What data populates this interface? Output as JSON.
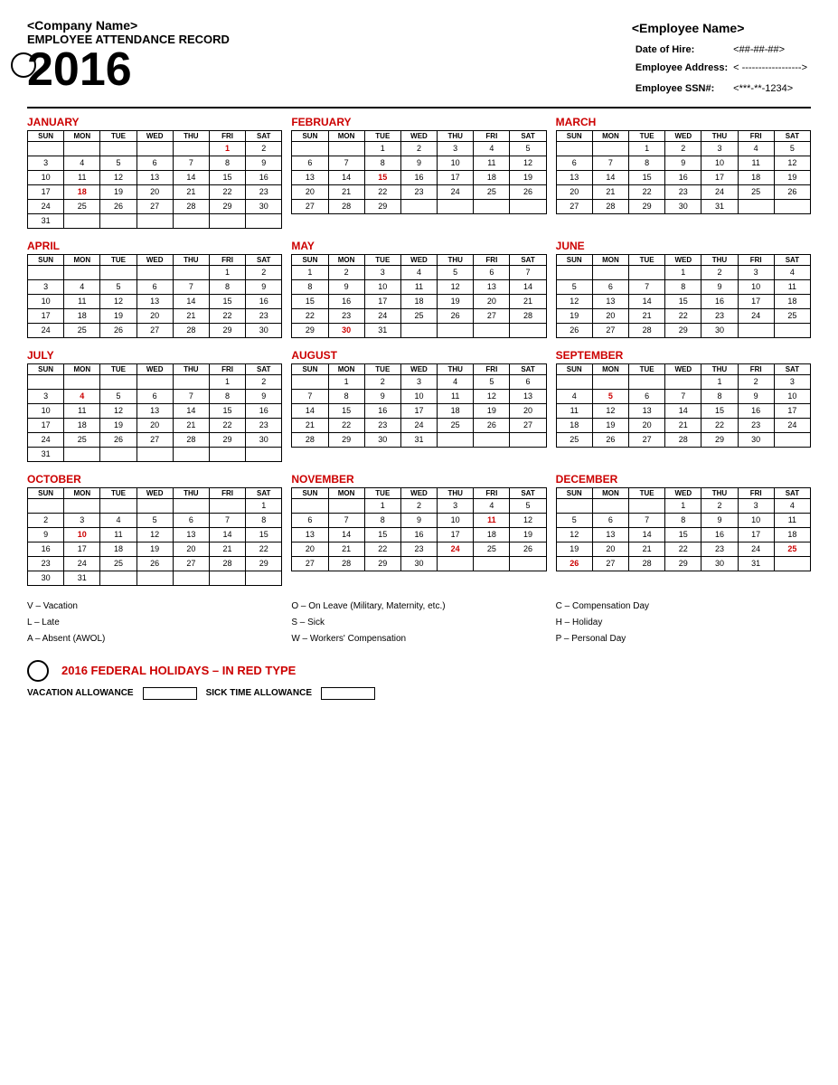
{
  "header": {
    "company_name": "<Company Name>",
    "record_title": "EMPLOYEE ATTENDANCE RECORD",
    "year": "2016",
    "employee_name": "<Employee Name>",
    "date_of_hire_label": "Date of Hire:",
    "date_of_hire_value": "<##-##-##>",
    "address_label": "Employee Address:",
    "address_value": "< ------------------>",
    "ssn_label": "Employee SSN#:",
    "ssn_value": "<***-**-1234>"
  },
  "months": [
    {
      "name": "JANUARY",
      "days": [
        "",
        "",
        "",
        "",
        "",
        "1",
        "2",
        "3",
        "4",
        "5",
        "6",
        "7",
        "8",
        "9",
        "10",
        "11",
        "12",
        "13",
        "14",
        "15",
        "16",
        "17",
        "18",
        "19",
        "20",
        "21",
        "22",
        "23",
        "24",
        "25",
        "26",
        "27",
        "28",
        "29",
        "30",
        "31"
      ],
      "red_days": [
        "1",
        "18"
      ]
    },
    {
      "name": "FEBRUARY",
      "days": [
        "",
        "",
        "1",
        "2",
        "3",
        "4",
        "5",
        "6",
        "7",
        "8",
        "9",
        "10",
        "11",
        "12",
        "13",
        "14",
        "15",
        "16",
        "17",
        "18",
        "19",
        "20",
        "21",
        "22",
        "23",
        "24",
        "25",
        "26",
        "27",
        "28",
        "29"
      ],
      "red_days": [
        "15"
      ]
    },
    {
      "name": "MARCH",
      "days": [
        "",
        "",
        "1",
        "2",
        "3",
        "4",
        "5",
        "6",
        "7",
        "8",
        "9",
        "10",
        "11",
        "12",
        "13",
        "14",
        "15",
        "16",
        "17",
        "18",
        "19",
        "20",
        "21",
        "22",
        "23",
        "24",
        "25",
        "26",
        "27",
        "28",
        "29",
        "30",
        "31"
      ],
      "red_days": []
    },
    {
      "name": "APRIL",
      "days": [
        "",
        "",
        "",
        "",
        "",
        "1",
        "2",
        "3",
        "4",
        "5",
        "6",
        "7",
        "8",
        "9",
        "10",
        "11",
        "12",
        "13",
        "14",
        "15",
        "16",
        "17",
        "18",
        "19",
        "20",
        "21",
        "22",
        "23",
        "24",
        "25",
        "26",
        "27",
        "28",
        "29",
        "30"
      ],
      "red_days": []
    },
    {
      "name": "MAY",
      "days": [
        "1",
        "2",
        "3",
        "4",
        "5",
        "6",
        "7",
        "8",
        "9",
        "10",
        "11",
        "12",
        "13",
        "14",
        "15",
        "16",
        "17",
        "18",
        "19",
        "20",
        "21",
        "22",
        "23",
        "24",
        "25",
        "26",
        "27",
        "28",
        "29",
        "30",
        "31"
      ],
      "red_days": [
        "30"
      ]
    },
    {
      "name": "JUNE",
      "days": [
        "",
        "",
        "",
        "1",
        "2",
        "3",
        "4",
        "5",
        "6",
        "7",
        "8",
        "9",
        "10",
        "11",
        "12",
        "13",
        "14",
        "15",
        "16",
        "17",
        "18",
        "19",
        "20",
        "21",
        "22",
        "23",
        "24",
        "25",
        "26",
        "27",
        "28",
        "29",
        "30"
      ],
      "red_days": []
    },
    {
      "name": "JULY",
      "days": [
        "",
        "",
        "",
        "",
        "",
        "1",
        "2",
        "3",
        "4",
        "5",
        "6",
        "7",
        "8",
        "9",
        "10",
        "11",
        "12",
        "13",
        "14",
        "15",
        "16",
        "17",
        "18",
        "19",
        "20",
        "21",
        "22",
        "23",
        "24",
        "25",
        "26",
        "27",
        "28",
        "29",
        "30",
        "31"
      ],
      "red_days": [
        "4"
      ]
    },
    {
      "name": "AUGUST",
      "days": [
        "",
        "1",
        "2",
        "3",
        "4",
        "5",
        "6",
        "7",
        "8",
        "9",
        "10",
        "11",
        "12",
        "13",
        "14",
        "15",
        "16",
        "17",
        "18",
        "19",
        "20",
        "21",
        "22",
        "23",
        "24",
        "25",
        "26",
        "27",
        "28",
        "29",
        "30",
        "31"
      ],
      "red_days": []
    },
    {
      "name": "SEPTEMBER",
      "days": [
        "",
        "",
        "",
        "",
        "1",
        "2",
        "3",
        "4",
        "5",
        "6",
        "7",
        "8",
        "9",
        "10",
        "11",
        "12",
        "13",
        "14",
        "15",
        "16",
        "17",
        "18",
        "19",
        "20",
        "21",
        "22",
        "23",
        "24",
        "25",
        "26",
        "27",
        "28",
        "29",
        "30"
      ],
      "red_days": [
        "5"
      ]
    },
    {
      "name": "OCTOBER",
      "days": [
        "",
        "",
        "",
        "",
        "",
        "",
        "1",
        "2",
        "3",
        "4",
        "5",
        "6",
        "7",
        "8",
        "9",
        "10",
        "11",
        "12",
        "13",
        "14",
        "15",
        "16",
        "17",
        "18",
        "19",
        "20",
        "21",
        "22",
        "23",
        "24",
        "25",
        "26",
        "27",
        "28",
        "29",
        "30",
        "31"
      ],
      "red_days": [
        "10"
      ]
    },
    {
      "name": "NOVEMBER",
      "days": [
        "",
        "",
        "1",
        "2",
        "3",
        "4",
        "5",
        "6",
        "7",
        "8",
        "9",
        "10",
        "11",
        "12",
        "13",
        "14",
        "15",
        "16",
        "17",
        "18",
        "19",
        "20",
        "21",
        "22",
        "23",
        "24",
        "25",
        "26",
        "27",
        "28",
        "29",
        "30"
      ],
      "red_days": [
        "11",
        "24"
      ]
    },
    {
      "name": "DECEMBER",
      "days": [
        "",
        "",
        "",
        "1",
        "2",
        "3",
        "4",
        "5",
        "6",
        "7",
        "8",
        "9",
        "10",
        "11",
        "12",
        "13",
        "14",
        "15",
        "16",
        "17",
        "18",
        "19",
        "20",
        "21",
        "22",
        "23",
        "24",
        "25",
        "26",
        "27",
        "28",
        "29",
        "30",
        "31"
      ],
      "red_days": [
        "25",
        "26"
      ]
    }
  ],
  "legend": {
    "col1": [
      "V – Vacation",
      "L – Late",
      "A – Absent (AWOL)"
    ],
    "col2": [
      "O – On Leave (Military, Maternity, etc.)",
      "S – Sick",
      "W – Workers' Compensation"
    ],
    "col3": [
      "C – Compensation Day",
      "H – Holiday",
      "P – Personal Day"
    ]
  },
  "holidays_title": "2016 FEDERAL HOLIDAYS – IN RED TYPE",
  "vacation_label": "VACATION ALLOWANCE",
  "sick_label": "SICK TIME  ALLOWANCE",
  "days_of_week": [
    "SUN",
    "MON",
    "TUE",
    "WED",
    "THU",
    "FRI",
    "SAT"
  ]
}
